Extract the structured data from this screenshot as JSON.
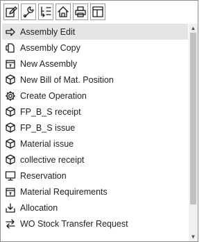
{
  "toolbar": [
    {
      "icon": "edit-icon"
    },
    {
      "icon": "wrench-icon"
    },
    {
      "icon": "tree-list-icon"
    },
    {
      "icon": "home-icon"
    },
    {
      "icon": "print-icon"
    },
    {
      "icon": "layout-icon"
    }
  ],
  "menu": {
    "items": [
      {
        "label": "Assembly Edit",
        "icon": "arrow-right-icon",
        "selected": true
      },
      {
        "label": "Assembly Copy",
        "icon": "copy-icon"
      },
      {
        "label": "New Assembly",
        "icon": "assembly-box-icon"
      },
      {
        "label": "New Bill of Mat. Position",
        "icon": "cube-icon"
      },
      {
        "label": "Create Operation",
        "icon": "gear-icon"
      },
      {
        "label": "FP_B_S receipt",
        "icon": "cube-icon"
      },
      {
        "label": "FP_B_S issue",
        "icon": "cube-icon"
      },
      {
        "label": "Material issue",
        "icon": "cube-icon"
      },
      {
        "label": "collective receipt",
        "icon": "cube-icon"
      },
      {
        "label": "Reservation",
        "icon": "monitor-icon"
      },
      {
        "label": "Material Requirements",
        "icon": "assembly-box-icon"
      },
      {
        "label": "Allocation",
        "icon": "download-tray-icon"
      },
      {
        "label": "WO Stock Transfer Request",
        "icon": "transfer-arrows-icon"
      }
    ]
  },
  "scroll": {
    "visible_fraction": 0.86,
    "position": 0
  }
}
